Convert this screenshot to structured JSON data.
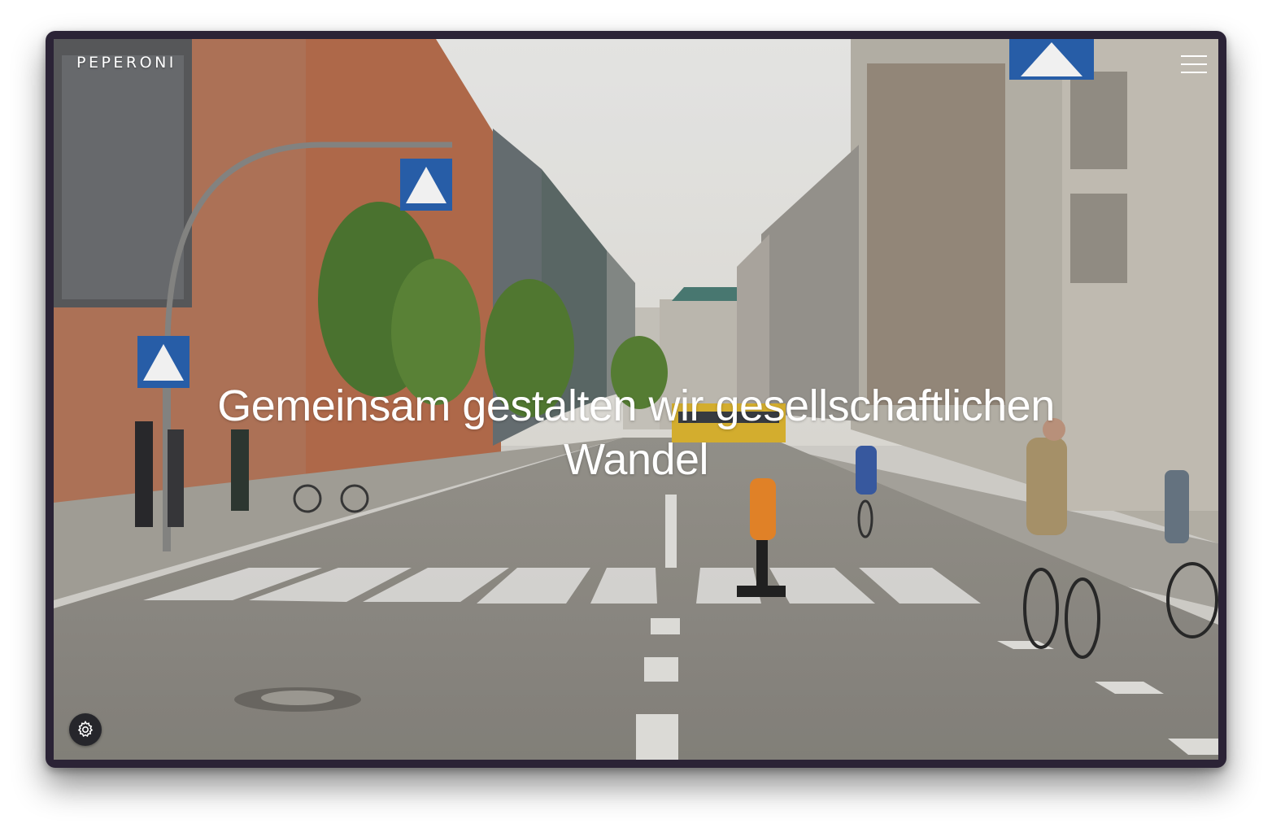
{
  "brand": {
    "name": "PEPERONI"
  },
  "hero": {
    "headline": "Gemeinsam gestalten wir gesellschaftlichen Wandel"
  },
  "nav": {
    "menu_icon": "hamburger-menu-icon"
  },
  "settings": {
    "icon": "gear-icon"
  },
  "colors": {
    "frame": "#2b2336",
    "text": "#ffffff",
    "settings_bg": "#26262b"
  }
}
